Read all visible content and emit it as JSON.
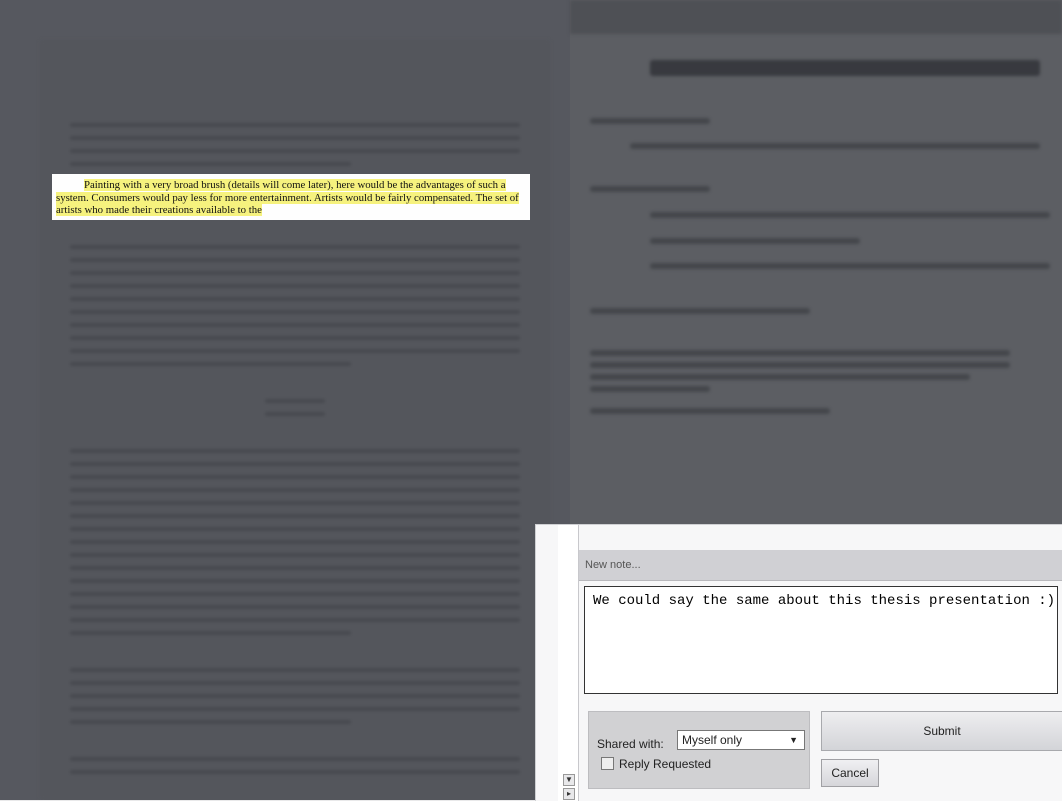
{
  "highlight": {
    "text": "Painting with a very broad brush (details will come later), here would be the advantages of such a system. Consumers would pay less for more entertainment. Artists would be fairly compensated. The set of artists who made their creations available to the"
  },
  "note": {
    "header": "New note...",
    "text": "We could say the same about this thesis presentation :)",
    "shared_with_label": "Shared with:",
    "shared_with_value": "Myself only",
    "reply_requested_label": "Reply Requested",
    "submit_label": "Submit",
    "cancel_label": "Cancel"
  },
  "icons": {
    "dropdown": "chevron-down-icon",
    "scroll_down": "arrow-down-icon",
    "scroll_right": "arrow-right-icon"
  }
}
